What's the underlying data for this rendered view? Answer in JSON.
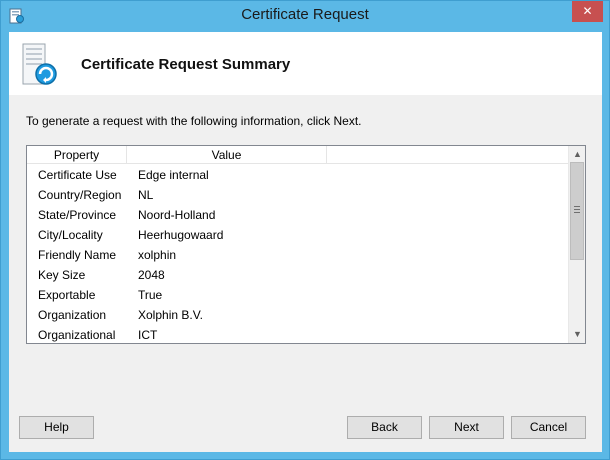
{
  "window": {
    "title": "Certificate Request",
    "close_glyph": "✕"
  },
  "header": {
    "title": "Certificate Request Summary",
    "icon": "certificate-request-icon"
  },
  "instruction": "To generate a request with the following information, click Next.",
  "table": {
    "columns": [
      "Property",
      "Value"
    ],
    "rows": [
      [
        "Certificate Use",
        "Edge internal"
      ],
      [
        "Country/Region",
        "NL"
      ],
      [
        "State/Province",
        "Noord-Holland"
      ],
      [
        "City/Locality",
        "Heerhugowaard"
      ],
      [
        "Friendly Name",
        "xolphin"
      ],
      [
        "Key Size",
        "2048"
      ],
      [
        "Exportable",
        "True"
      ],
      [
        "Organization",
        "Xolphin B.V."
      ],
      [
        "Organizational",
        "ICT"
      ]
    ]
  },
  "buttons": {
    "help": "Help",
    "back": "Back",
    "next": "Next",
    "cancel": "Cancel"
  },
  "colors": {
    "frame": "#5bb8e6",
    "close": "#c75050",
    "client": "#f0f0f0"
  }
}
